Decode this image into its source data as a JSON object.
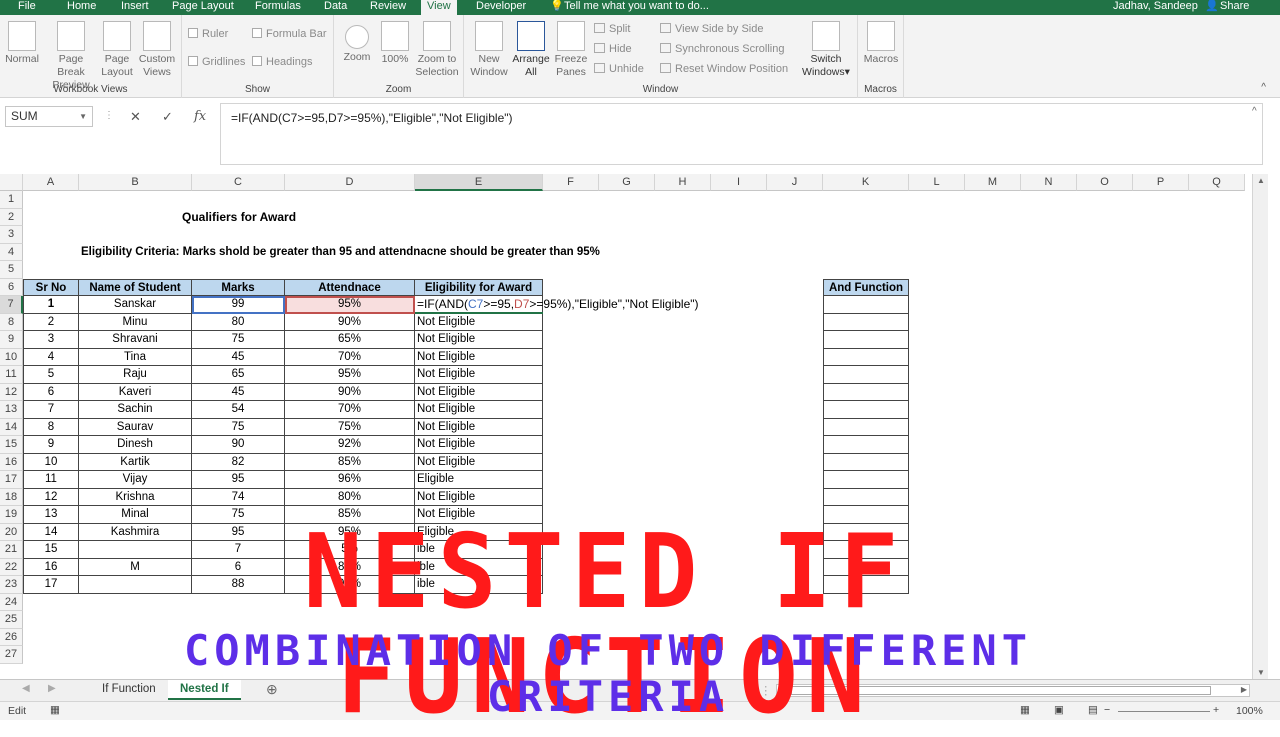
{
  "tabs": {
    "items": [
      "File",
      "Home",
      "Insert",
      "Page Layout",
      "Formulas",
      "Data",
      "Review",
      "View",
      "Developer"
    ],
    "active": "View",
    "tell_me": "Tell me what you want to do...",
    "user": "Jadhav, Sandeep",
    "share": "Share"
  },
  "ribbon": {
    "workbook_views": {
      "label": "Workbook Views",
      "buttons": [
        "Normal",
        "Page Break Preview",
        "Page Layout",
        "Custom Views"
      ]
    },
    "show": {
      "label": "Show",
      "ruler": "Ruler",
      "formula_bar": "Formula Bar",
      "gridlines": "Gridlines",
      "headings": "Headings"
    },
    "zoom": {
      "label": "Zoom",
      "buttons": [
        "Zoom",
        "100%",
        "Zoom to Selection"
      ]
    },
    "window": {
      "label": "Window",
      "new_window": "New Window",
      "arrange_all": "Arrange All",
      "freeze_panes": "Freeze Panes",
      "split": "Split",
      "hide": "Hide",
      "unhide": "Unhide",
      "side_by_side": "View Side by Side",
      "sync_scroll": "Synchronous Scrolling",
      "reset_pos": "Reset Window Position",
      "switch_windows": "Switch Windows"
    },
    "macros": {
      "label": "Macros",
      "button": "Macros"
    }
  },
  "formula_bar": {
    "name_box": "SUM",
    "formula": "=IF(AND(C7>=95,D7>=95%),\"Eligible\",\"Not Eligible\")"
  },
  "columns": [
    "A",
    "B",
    "C",
    "D",
    "E",
    "F",
    "G",
    "H",
    "I",
    "J",
    "K",
    "L",
    "M",
    "N",
    "O",
    "P",
    "Q"
  ],
  "rows": [
    "1",
    "2",
    "3",
    "4",
    "5",
    "6",
    "7",
    "8",
    "9",
    "10",
    "11",
    "12",
    "13",
    "14",
    "15",
    "16",
    "17",
    "18",
    "19",
    "20",
    "21",
    "22",
    "23",
    "24",
    "25",
    "26",
    "27"
  ],
  "sheet": {
    "title": "Qualifiers for Award",
    "criteria": "Eligibility Criteria: Marks shold be greater than 95 and attendnacne should be greater than 95%",
    "headers": [
      "Sr No",
      "Name of Student",
      "Marks",
      "Attendnace",
      "Eligibility for Award"
    ],
    "and_header": "And Function",
    "edit_formula": {
      "p1": "=IF(AND(",
      "p2": "C7",
      "p3": ">=95,",
      "p4": "D7",
      "p5": ">=95%),\"Eligible\",\"Not Eligible\")"
    },
    "data": [
      [
        "1",
        "Sanskar",
        "99",
        "95%",
        ""
      ],
      [
        "2",
        "Minu",
        "80",
        "90%",
        "Not Eligible"
      ],
      [
        "3",
        "Shravani",
        "75",
        "65%",
        "Not Eligible"
      ],
      [
        "4",
        "Tina",
        "45",
        "70%",
        "Not Eligible"
      ],
      [
        "5",
        "Raju",
        "65",
        "95%",
        "Not Eligible"
      ],
      [
        "6",
        "Kaveri",
        "45",
        "90%",
        "Not Eligible"
      ],
      [
        "7",
        "Sachin",
        "54",
        "70%",
        "Not Eligible"
      ],
      [
        "8",
        "Saurav",
        "75",
        "75%",
        "Not Eligible"
      ],
      [
        "9",
        "Dinesh",
        "90",
        "92%",
        "Not Eligible"
      ],
      [
        "10",
        "Kartik",
        "82",
        "85%",
        "Not Eligible"
      ],
      [
        "11",
        "Vijay",
        "95",
        "96%",
        "Eligible"
      ],
      [
        "12",
        "Krishna",
        "74",
        "80%",
        "Not Eligible"
      ],
      [
        "13",
        "Minal",
        "75",
        "85%",
        "Not Eligible"
      ],
      [
        "14",
        "Kashmira",
        "95",
        "95%",
        "Eligible"
      ],
      [
        "15",
        "",
        "7",
        "5%",
        "ible"
      ],
      [
        "16",
        "M",
        "6",
        "85%",
        "ible"
      ],
      [
        "17",
        "",
        "88",
        "95%",
        "ible"
      ]
    ]
  },
  "sheet_tabs": {
    "items": [
      "If Function",
      "Nested If"
    ],
    "active": "Nested If"
  },
  "status": {
    "mode": "Edit",
    "zoom": "100%"
  },
  "overlay": {
    "title": "NESTED IF FUNCTION",
    "subtitle": "COMBINATION OF TWO DIFFERENT CRITERIA"
  },
  "colors": {
    "excel_green": "#217346",
    "header_fill": "#bdd7ee",
    "overlay_red": "#ff1a1a",
    "overlay_purple": "#5d2ee8"
  }
}
